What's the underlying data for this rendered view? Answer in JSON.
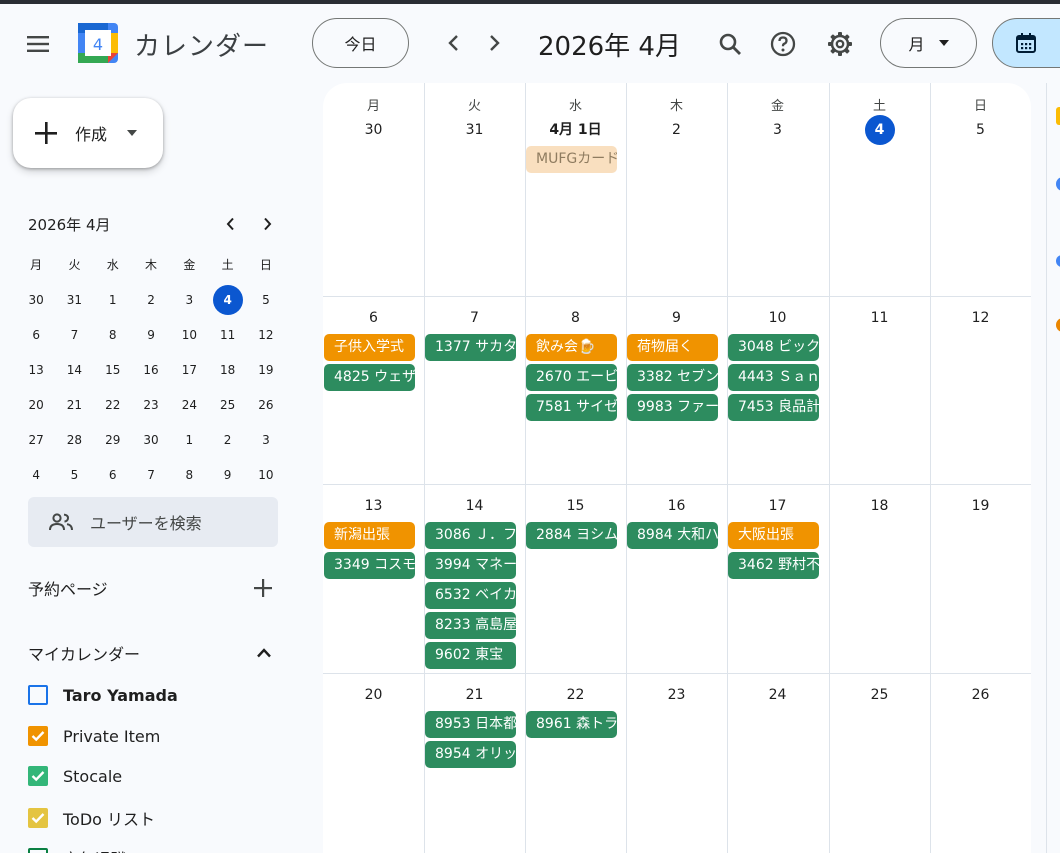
{
  "header": {
    "app_title": "カレンダー",
    "logo_day": "4",
    "today_label": "今日",
    "date_title": "2026年 4月",
    "view_label": "月"
  },
  "sidebar": {
    "create_label": "作成",
    "mini_calendar": {
      "title": "2026年 4月",
      "weekdays": [
        "月",
        "火",
        "水",
        "木",
        "金",
        "土",
        "日"
      ],
      "weeks": [
        [
          "30",
          "31",
          "1",
          "2",
          "3",
          "4",
          "5"
        ],
        [
          "6",
          "7",
          "8",
          "9",
          "10",
          "11",
          "12"
        ],
        [
          "13",
          "14",
          "15",
          "16",
          "17",
          "18",
          "19"
        ],
        [
          "20",
          "21",
          "22",
          "23",
          "24",
          "25",
          "26"
        ],
        [
          "27",
          "28",
          "29",
          "30",
          "1",
          "2",
          "3"
        ],
        [
          "4",
          "5",
          "6",
          "7",
          "8",
          "9",
          "10"
        ]
      ],
      "today": "4"
    },
    "user_search_placeholder": "ユーザーを検索",
    "booking_pages_label": "予約ページ",
    "my_calendars_label": "マイカレンダー",
    "calendars": [
      {
        "name": "Taro Yamada",
        "color": "#1a73e8",
        "checked": false
      },
      {
        "name": "Private Item",
        "color": "#f09300",
        "checked": true
      },
      {
        "name": "Stocale",
        "color": "#33b679",
        "checked": true
      },
      {
        "name": "ToDo リスト",
        "color": "#e4c441",
        "checked": true
      },
      {
        "name": "定年退職",
        "color": "#0b8043",
        "checked": false
      }
    ]
  },
  "calendar": {
    "weekdays": [
      "月",
      "火",
      "水",
      "木",
      "金",
      "土",
      "日"
    ],
    "weeks": [
      {
        "days": [
          "30",
          "31",
          "4月 1日",
          "2",
          "3",
          "4",
          "5"
        ],
        "events": [
          {
            "day": 2,
            "label": "MUFGカード",
            "color": "peach"
          }
        ]
      },
      {
        "days": [
          "6",
          "7",
          "8",
          "9",
          "10",
          "11",
          "12"
        ],
        "events": [
          {
            "day": 0,
            "row": 0,
            "label": "子供入学式",
            "color": "orange"
          },
          {
            "day": 0,
            "row": 1,
            "label": "4825 ウェザ",
            "color": "green"
          },
          {
            "day": 1,
            "row": 0,
            "label": "1377 サカタ",
            "color": "green"
          },
          {
            "day": 2,
            "row": 0,
            "label": "飲み会🍺",
            "color": "orange"
          },
          {
            "day": 2,
            "row": 1,
            "label": "2670 エービ",
            "color": "green"
          },
          {
            "day": 2,
            "row": 2,
            "label": "7581 サイゼ",
            "color": "green"
          },
          {
            "day": 3,
            "row": 0,
            "label": "荷物届く",
            "color": "orange"
          },
          {
            "day": 3,
            "row": 1,
            "label": "3382 セブン",
            "color": "green"
          },
          {
            "day": 3,
            "row": 2,
            "label": "9983 ファー",
            "color": "green"
          },
          {
            "day": 4,
            "row": 0,
            "label": "3048 ビック",
            "color": "green"
          },
          {
            "day": 4,
            "row": 1,
            "label": "4443 Ｓａｎ",
            "color": "green"
          },
          {
            "day": 4,
            "row": 2,
            "label": "7453 良品計",
            "color": "green"
          }
        ]
      },
      {
        "days": [
          "13",
          "14",
          "15",
          "16",
          "17",
          "18",
          "19"
        ],
        "events": [
          {
            "day": 0,
            "row": 0,
            "label": "新潟出張",
            "color": "orange"
          },
          {
            "day": 0,
            "row": 1,
            "label": "3349 コスモ",
            "color": "green"
          },
          {
            "day": 1,
            "row": 0,
            "label": "3086 Ｊ．フ",
            "color": "green"
          },
          {
            "day": 1,
            "row": 1,
            "label": "3994 マネー",
            "color": "green"
          },
          {
            "day": 1,
            "row": 2,
            "label": "6532 ベイカ",
            "color": "green"
          },
          {
            "day": 1,
            "row": 3,
            "label": "8233 高島屋",
            "color": "green"
          },
          {
            "day": 1,
            "row": 4,
            "label": "9602 東宝",
            "color": "green"
          },
          {
            "day": 2,
            "row": 0,
            "label": "2884 ヨシム",
            "color": "green"
          },
          {
            "day": 3,
            "row": 0,
            "label": "8984 大和ハ",
            "color": "green"
          },
          {
            "day": 4,
            "row": 0,
            "label": "大阪出張",
            "color": "orange"
          },
          {
            "day": 4,
            "row": 1,
            "label": "3462 野村不",
            "color": "green"
          }
        ]
      },
      {
        "days": [
          "20",
          "21",
          "22",
          "23",
          "24",
          "25",
          "26"
        ],
        "events": [
          {
            "day": 1,
            "row": 0,
            "label": "8953 日本都",
            "color": "green"
          },
          {
            "day": 1,
            "row": 1,
            "label": "8954 オリッ",
            "color": "green"
          },
          {
            "day": 2,
            "row": 0,
            "label": "8961 森トラ",
            "color": "green"
          }
        ]
      }
    ],
    "today_label": "4"
  }
}
